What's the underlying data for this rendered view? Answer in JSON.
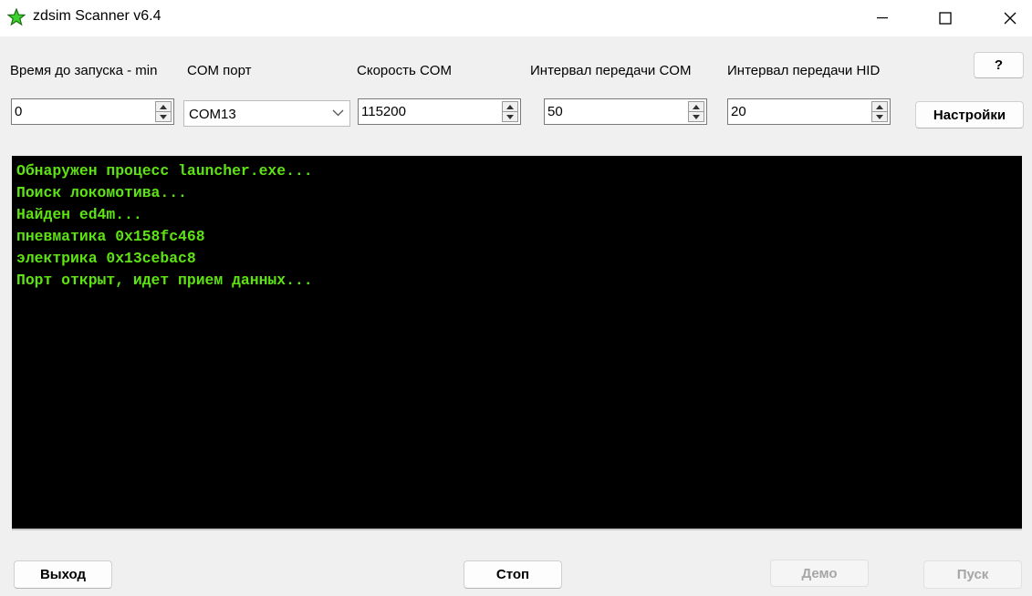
{
  "window": {
    "title": "zdsim Scanner v6.4",
    "icon": "green-star-icon",
    "controls": [
      "minimize-icon",
      "maximize-icon",
      "close-icon"
    ]
  },
  "settings": {
    "startup_delay": {
      "label": "Время до запуска - min",
      "value": "0"
    },
    "com_port": {
      "label": "COM порт",
      "value": "COM13"
    },
    "com_speed": {
      "label": "Скорость COM",
      "value": "115200"
    },
    "com_interval": {
      "label": "Интервал передачи COM",
      "value": "50"
    },
    "hid_interval": {
      "label": "Интервал передачи HID",
      "value": "20"
    }
  },
  "buttons": {
    "help": "?",
    "settings": "Настройки",
    "exit": "Выход",
    "stop": "Стоп",
    "demo": "Демо",
    "start": "Пуск"
  },
  "console": {
    "lines": [
      "Обнаружен процесс launcher.exe...",
      "Поиск локомотива...",
      "Найден ed4m...",
      "пневматика 0x158fc468",
      "электрика 0x13cebac8",
      "Порт открыт, идет прием данных..."
    ],
    "text_color": "#5ee312",
    "background": "#000000"
  }
}
